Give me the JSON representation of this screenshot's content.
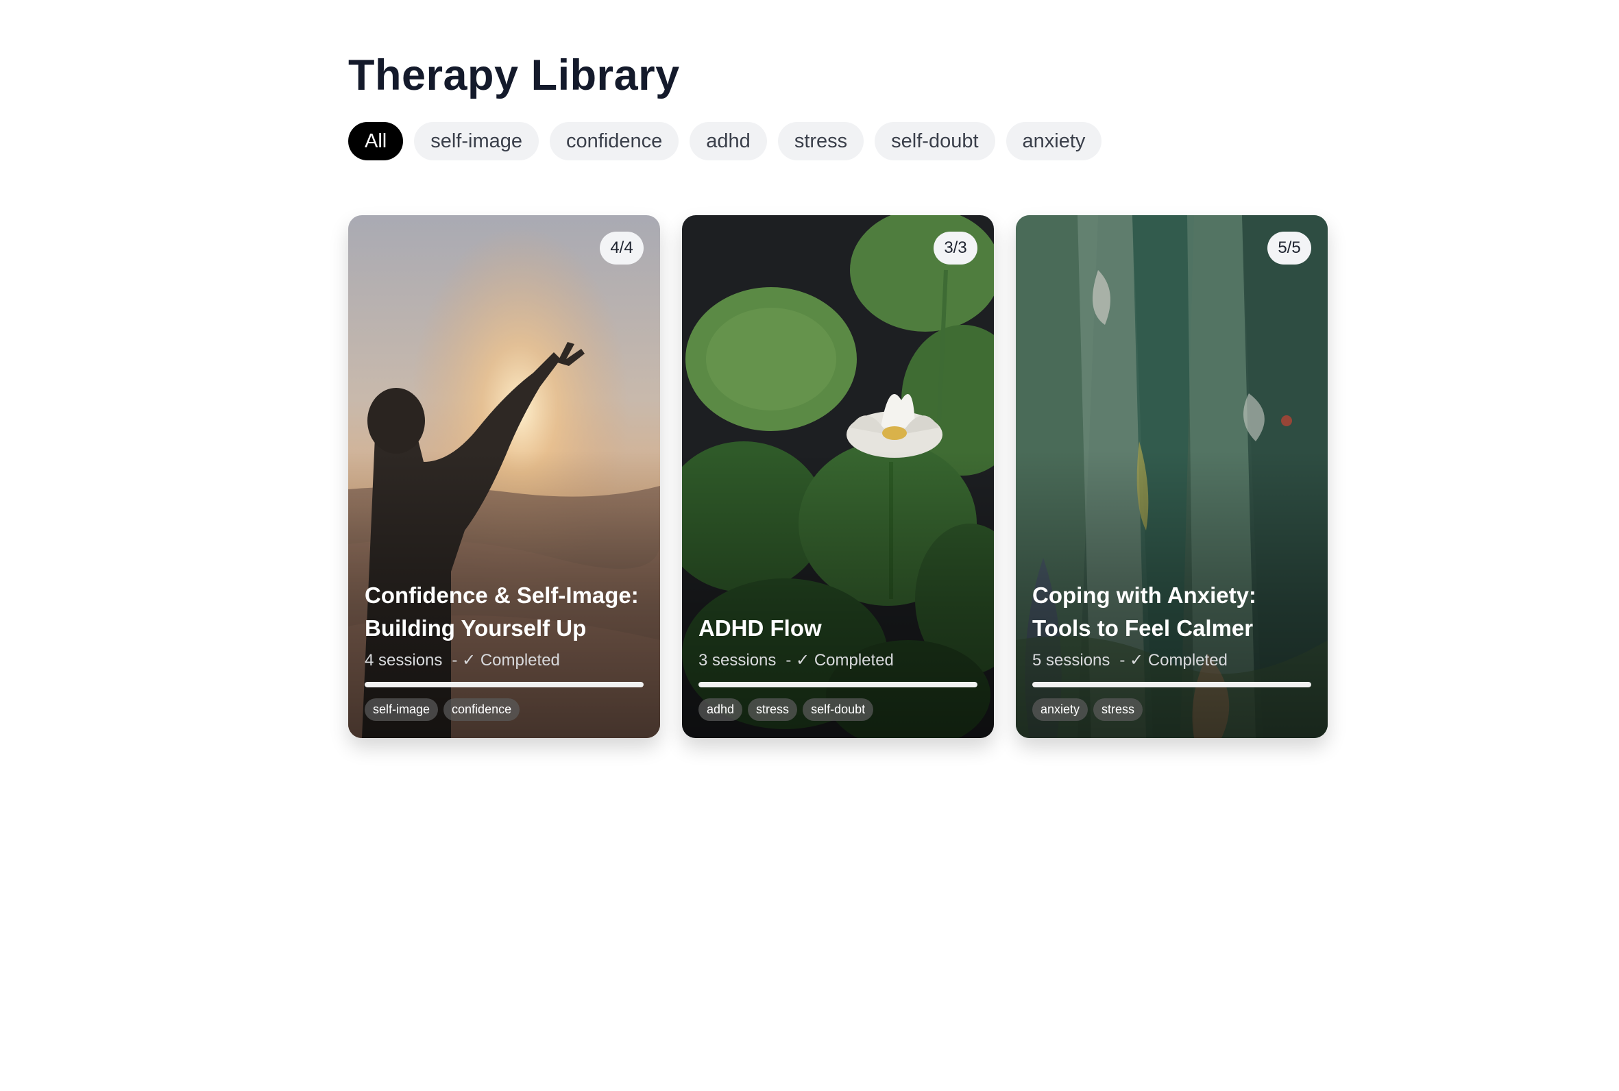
{
  "header": {
    "title": "Therapy Library"
  },
  "filters": [
    {
      "label": "All",
      "active": true
    },
    {
      "label": "self-image",
      "active": false
    },
    {
      "label": "confidence",
      "active": false
    },
    {
      "label": "adhd",
      "active": false
    },
    {
      "label": "stress",
      "active": false
    },
    {
      "label": "self-doubt",
      "active": false
    },
    {
      "label": "anxiety",
      "active": false
    }
  ],
  "cards": [
    {
      "badge": "4/4",
      "title": "Confidence & Self-Image: Building Yourself Up",
      "sessions": "4 sessions",
      "status": "- ✓ Completed",
      "progress": 1.0,
      "tags": [
        "self-image",
        "confidence"
      ],
      "image": "sunset-desert-raised-hand"
    },
    {
      "badge": "3/3",
      "title": "ADHD Flow",
      "sessions": "3 sessions",
      "status": "- ✓ Completed",
      "progress": 1.0,
      "tags": [
        "adhd",
        "stress",
        "self-doubt"
      ],
      "image": "white-lotus-green-leaves"
    },
    {
      "badge": "5/5",
      "title": "Coping with Anxiety: Tools to Feel Calmer",
      "sessions": "5 sessions",
      "status": "- ✓ Completed",
      "progress": 1.0,
      "tags": [
        "anxiety",
        "stress"
      ],
      "image": "abstract-green-painting"
    }
  ]
}
